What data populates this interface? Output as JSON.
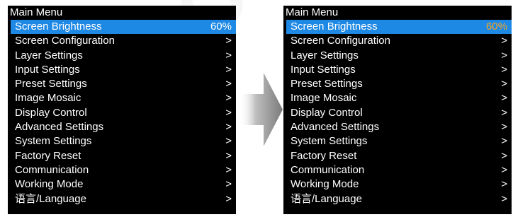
{
  "watermark": "NOVASTAR",
  "accent_color": "#1e88e5",
  "value_highlight_color": "#f5a623",
  "left_panel": {
    "title": "Main Menu",
    "items": [
      {
        "label": "Screen Brightness",
        "value": "60%"
      },
      {
        "label": "Screen Configuration",
        "value": ">"
      },
      {
        "label": "Layer Settings",
        "value": ">"
      },
      {
        "label": "Input Settings",
        "value": ">"
      },
      {
        "label": "Preset Settings",
        "value": ">"
      },
      {
        "label": "Image Mosaic",
        "value": ">"
      },
      {
        "label": "Display Control",
        "value": ">"
      },
      {
        "label": "Advanced Settings",
        "value": ">"
      },
      {
        "label": "System Settings",
        "value": ">"
      },
      {
        "label": "Factory Reset",
        "value": ">"
      },
      {
        "label": "Communication",
        "value": ">"
      },
      {
        "label": "Working Mode",
        "value": ">"
      },
      {
        "label": "语言/Language",
        "value": ">"
      }
    ]
  },
  "right_panel": {
    "title": "Main Menu",
    "items": [
      {
        "label": "Screen Brightness",
        "value": "60%"
      },
      {
        "label": "Screen Configuration",
        "value": ">"
      },
      {
        "label": "Layer Settings",
        "value": ">"
      },
      {
        "label": "Input Settings",
        "value": ">"
      },
      {
        "label": "Preset Settings",
        "value": ">"
      },
      {
        "label": "Image Mosaic",
        "value": ">"
      },
      {
        "label": "Display Control",
        "value": ">"
      },
      {
        "label": "Advanced Settings",
        "value": ">"
      },
      {
        "label": "System Settings",
        "value": ">"
      },
      {
        "label": "Factory Reset",
        "value": ">"
      },
      {
        "label": "Communication",
        "value": ">"
      },
      {
        "label": "Working Mode",
        "value": ">"
      },
      {
        "label": "语言/Language",
        "value": ">"
      }
    ]
  },
  "arrow_icon": "arrow-right-icon"
}
